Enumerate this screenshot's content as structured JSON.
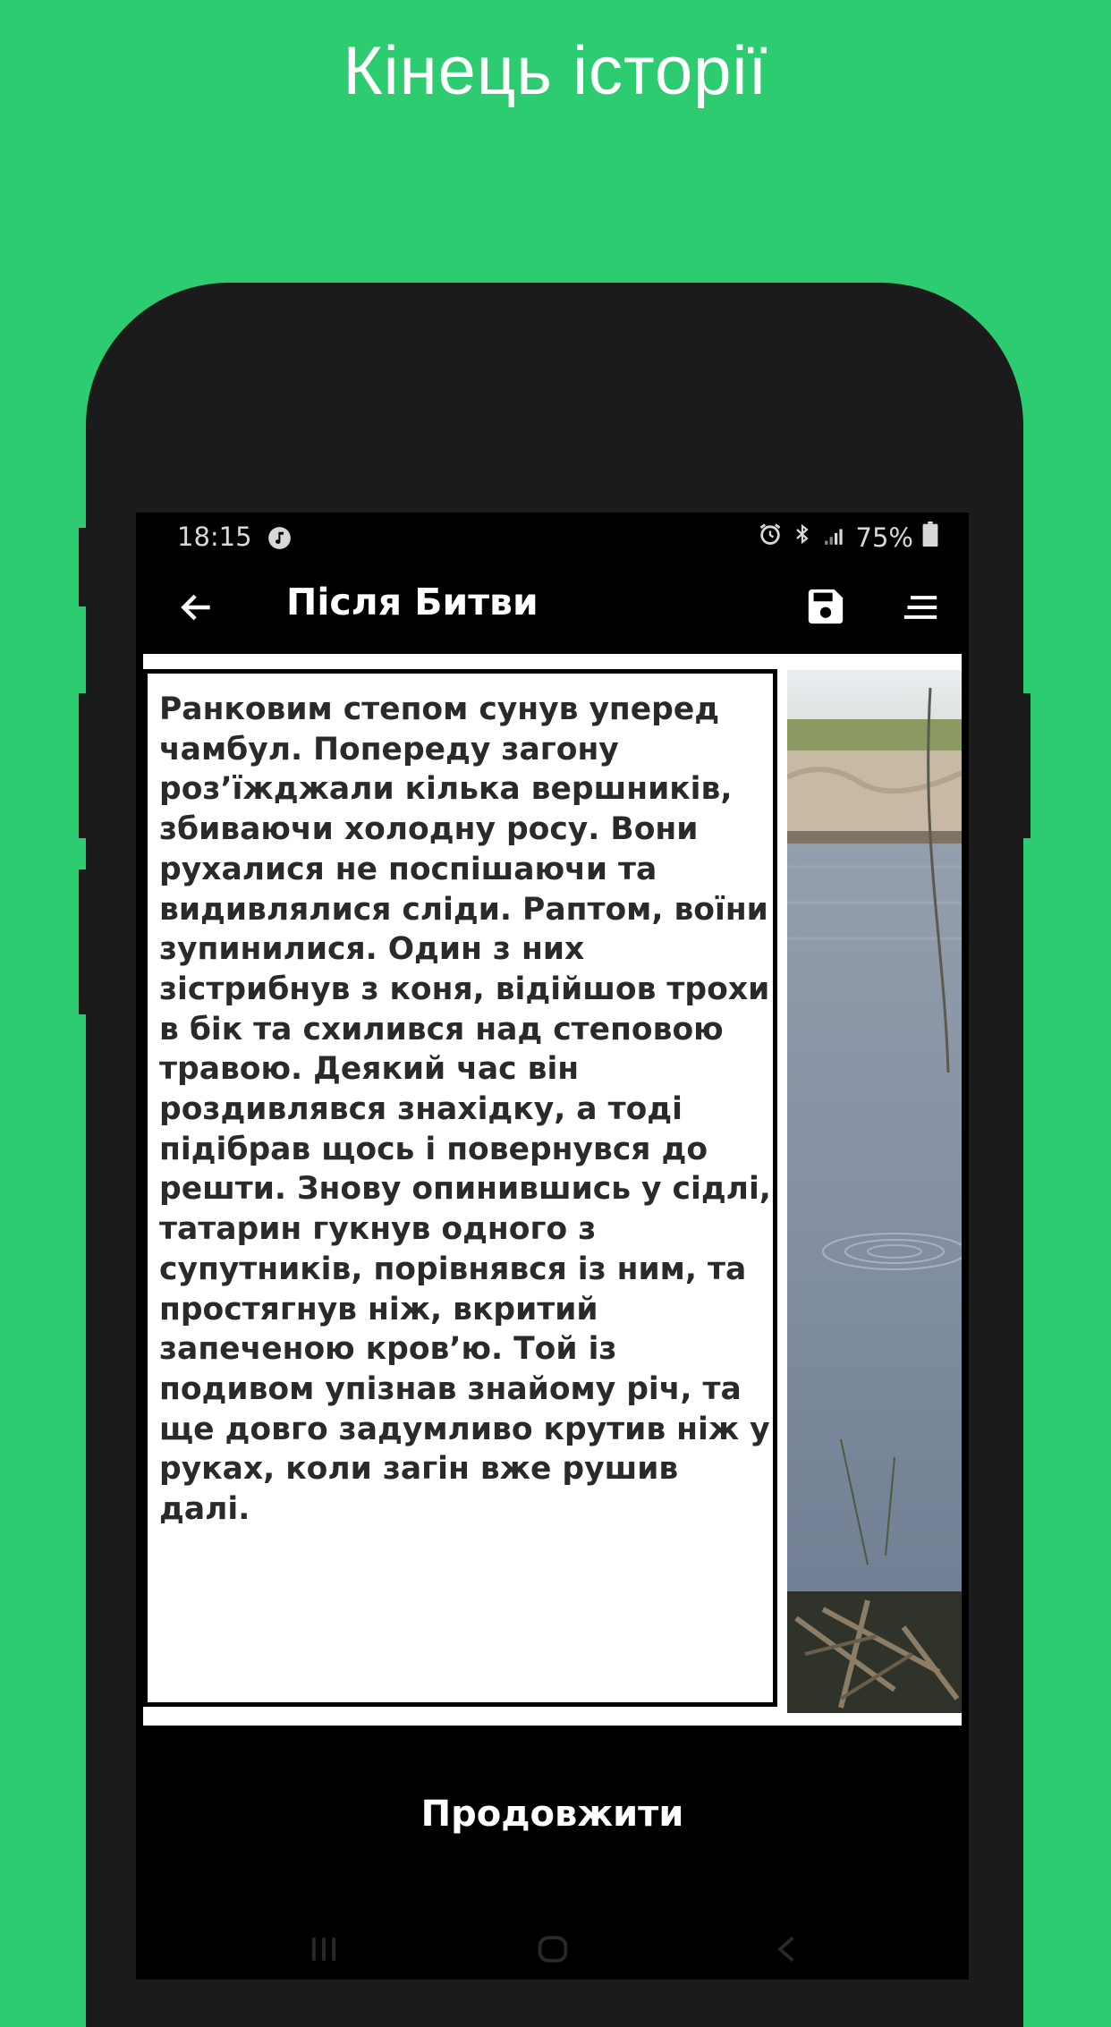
{
  "promo": {
    "title": "Кінець історії"
  },
  "status_bar": {
    "time": "18:15",
    "battery": "75%"
  },
  "app_bar": {
    "title": "Після Битви"
  },
  "story": {
    "text": "Ранковим степом сунув уперед чамбул. Попереду загону роз’їжджали кілька вершників, збиваючи холодну росу. Вони рухалися не поспішаючи та видивлялися сліди. Раптом, воїни зупинилися. Один з них зістрибнув з коня, відійшов трохи в бік та схилився над степовою травою. Деякий час він роздивлявся знахідку, а тоді підібрав щось і повернувся до решти. Знову опинившись у сідлі, татарин гукнув одного з супутників, порівнявся із ним, та простягнув ніж, вкритий запеченою кров’ю. Той із подивом упізнав знайому річ, та ще довго задумливо крутив ніж у руках, коли загін вже рушив далі."
  },
  "actions": {
    "continue_label": "Продовжити"
  },
  "colors": {
    "background": "#2ecc71",
    "phone": "#1b1b1b",
    "screen": "#000000"
  },
  "icons": [
    "music-icon",
    "alarm-icon",
    "bluetooth-icon",
    "signal-icon",
    "battery-icon",
    "back-arrow-icon",
    "save-icon",
    "sort-menu-icon",
    "recents-icon",
    "home-icon",
    "nav-back-icon"
  ]
}
